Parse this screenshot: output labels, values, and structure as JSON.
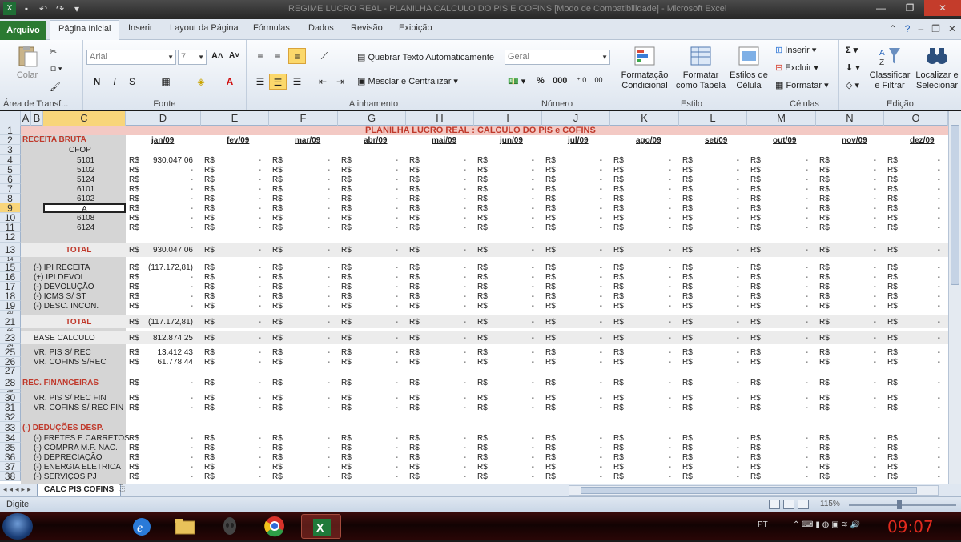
{
  "window": {
    "title": "REGIME LUCRO REAL - PLANILHA CALCULO DO PIS E COFINS  [Modo de Compatibilidade]  -  Microsoft Excel"
  },
  "tabs": {
    "file": "Arquivo",
    "items": [
      "Página Inicial",
      "Inserir",
      "Layout da Página",
      "Fórmulas",
      "Dados",
      "Revisão",
      "Exibição"
    ]
  },
  "ribbon": {
    "clipboard": {
      "paste": "Colar",
      "label": "Área de Transf..."
    },
    "font": {
      "name": "Arial",
      "size": "7",
      "bold": "N",
      "italic": "I",
      "underline": "S",
      "label": "Fonte"
    },
    "alignment": {
      "wrap": "Quebrar Texto Automaticamente",
      "merge": "Mesclar e Centralizar",
      "label": "Alinhamento"
    },
    "number": {
      "format": "Geral",
      "percent": "%",
      "thousands": "000",
      "label": "Número"
    },
    "styles": {
      "conditional": "Formatação Condicional",
      "as_table": "Formatar como Tabela",
      "cell_styles": "Estilos de Célula",
      "label": "Estilo"
    },
    "cells": {
      "insert": "Inserir",
      "delete": "Excluir",
      "format": "Formatar",
      "label": "Células"
    },
    "editing": {
      "sort": "Classificar e Filtrar",
      "find": "Localizar e Selecionar",
      "label": "Edição"
    }
  },
  "columns": [
    "A",
    "B",
    "C",
    "D",
    "E",
    "F",
    "G",
    "H",
    "I",
    "J",
    "K",
    "L",
    "M",
    "N",
    "O"
  ],
  "sheet": {
    "title": "PLANILHA LUCRO REAL : CALCULO DO PIS e COFINS",
    "receita_bruta": "RECEITA BRUTA",
    "months": [
      "jan/09",
      "fev/09",
      "mar/09",
      "abr/09",
      "mai/09",
      "jun/09",
      "jul/09",
      "ago/09",
      "set/09",
      "out/09",
      "nov/09",
      "dez/09"
    ],
    "cfop": "CFOP",
    "currency": "R$",
    "dash": "-",
    "rows": [
      {
        "n": "4",
        "label": "5101",
        "jan": "930.047,06"
      },
      {
        "n": "5",
        "label": "5102",
        "jan": "-"
      },
      {
        "n": "6",
        "label": "5124",
        "jan": "-"
      },
      {
        "n": "7",
        "label": "6101",
        "jan": "-"
      },
      {
        "n": "8",
        "label": "6102",
        "jan": "-"
      },
      {
        "n": "9",
        "label": "A",
        "jan": "-"
      },
      {
        "n": "10",
        "label": "6108",
        "jan": "-"
      },
      {
        "n": "11",
        "label": "6124",
        "jan": "-"
      },
      {
        "n": "13",
        "label": "TOTAL",
        "jan": "930.047,06"
      },
      {
        "n": "15",
        "label": "(-) IPI RECEITA",
        "jan": "(117.172,81)"
      },
      {
        "n": "16",
        "label": "(+) IPI DEVOL.",
        "jan": "-"
      },
      {
        "n": "17",
        "label": "(-) DEVOLUÇÃO",
        "jan": "-"
      },
      {
        "n": "18",
        "label": "(-) ICMS S/ ST",
        "jan": "-"
      },
      {
        "n": "19",
        "label": "(-) DESC. INCON.",
        "jan": "-"
      },
      {
        "n": "21",
        "label": "TOTAL",
        "jan": "(117.172,81)"
      },
      {
        "n": "23",
        "label": "BASE CALCULO",
        "jan": "812.874,25"
      },
      {
        "n": "25",
        "label": "VR. PIS S/ REC",
        "jan": "13.412,43"
      },
      {
        "n": "26",
        "label": "VR. COFINS S/REC",
        "jan": "61.778,44"
      },
      {
        "n": "28",
        "label": "REC. FINANCEIRAS",
        "jan": "-"
      },
      {
        "n": "30",
        "label": "VR. PIS S/ REC FIN",
        "jan": "-"
      },
      {
        "n": "31",
        "label": "VR. COFINS S/ REC FIN",
        "jan": "-"
      },
      {
        "n": "33",
        "label": "(-) DEDUÇÕES DESP.",
        "jan": ""
      },
      {
        "n": "34",
        "label": "(-) FRETES E CARRETOS",
        "jan": "-"
      },
      {
        "n": "35",
        "label": "(-) COMPRA M.P. NAC.",
        "jan": "-"
      },
      {
        "n": "36",
        "label": "(-) DEPRECIAÇÃO",
        "jan": "-"
      },
      {
        "n": "37",
        "label": "(-) ENERGIA ELETRICA",
        "jan": "-"
      },
      {
        "n": "38",
        "label": "(-) SERVIÇOS PJ",
        "jan": "-"
      }
    ],
    "tab_name": "CALC PIS COFINS"
  },
  "status": {
    "mode": "Digite",
    "zoom": "115%"
  },
  "taskbar": {
    "lang": "PT",
    "time": "09:07"
  }
}
